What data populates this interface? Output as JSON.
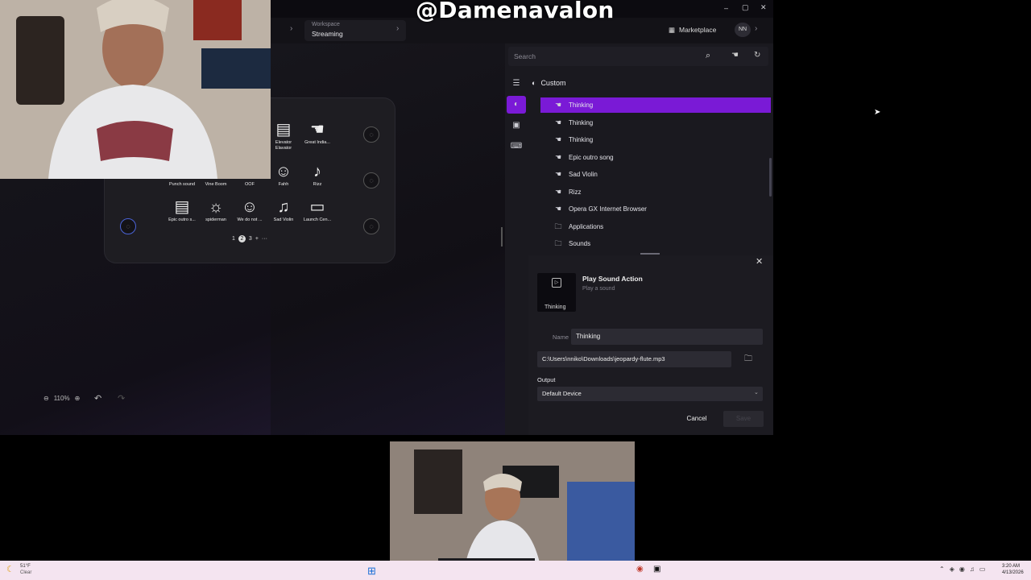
{
  "watermark": "@Damenavalon",
  "window": {
    "minimize": "–",
    "maximize": "▢",
    "close": "✕"
  },
  "breadcrumb": {
    "workspace_label": "Workspace",
    "workspace_value": "Streaming"
  },
  "header": {
    "marketplace": "Marketplace",
    "avatar_initials": "NN"
  },
  "search": {
    "placeholder": "Search"
  },
  "library": {
    "header": "Custom",
    "items": [
      {
        "label": "Thinking",
        "icon": "hand-icon",
        "selected": true
      },
      {
        "label": "Thinking",
        "icon": "hand-icon"
      },
      {
        "label": "Thinking",
        "icon": "hand-icon"
      },
      {
        "label": "Epic outro song",
        "icon": "hand-icon"
      },
      {
        "label": "Sad Violin",
        "icon": "hand-icon"
      },
      {
        "label": "Rizz",
        "icon": "hand-icon"
      },
      {
        "label": "Opera GX Internet Browser",
        "icon": "hand-icon"
      },
      {
        "label": "Applications",
        "icon": "folder-icon"
      },
      {
        "label": "Sounds",
        "icon": "folder-icon"
      }
    ]
  },
  "editor": {
    "title": "Play Sound Action",
    "subtitle": "Play a sound",
    "thumb_label": "Thinking",
    "name_label": "Name",
    "name_value": "Thinking",
    "path_value": "C:\\Users\\nniko\\Downloads\\jeopardy-flute.mp3",
    "output_label": "Output",
    "output_value": "Default Device",
    "cancel": "Cancel",
    "save": "Save"
  },
  "device": {
    "keys": [
      {
        "top": "",
        "label": "Elevator\nElavator"
      },
      {
        "top": "Great Indian song",
        "label": "Great India..."
      },
      {
        "top": "Punch sound",
        "label": "Punch sound"
      },
      {
        "top": "Vine Boom",
        "label": "Vine Boom"
      },
      {
        "top": "OOF",
        "label": "OOF"
      },
      {
        "top": "FAHH",
        "label": "Fahh"
      },
      {
        "top": "Rizz",
        "label": "Rizz"
      },
      {
        "top": "Epic outro song",
        "label": "Epic outro s..."
      },
      {
        "top": "spiderman",
        "label": "spiderman"
      },
      {
        "top": "We do not Care",
        "label": "We do not ..."
      },
      {
        "top": "Sad Violin",
        "label": "Sad Violin"
      },
      {
        "top": "Launch Center",
        "label": "Launch Cen..."
      }
    ],
    "pages": [
      "1",
      "2",
      "3",
      "+",
      "···"
    ]
  },
  "zoom": {
    "level": "110%"
  },
  "taskbar": {
    "temp": "51°F",
    "weather": "Clear",
    "time": "3:20 AM",
    "date": "4/13/2026"
  }
}
